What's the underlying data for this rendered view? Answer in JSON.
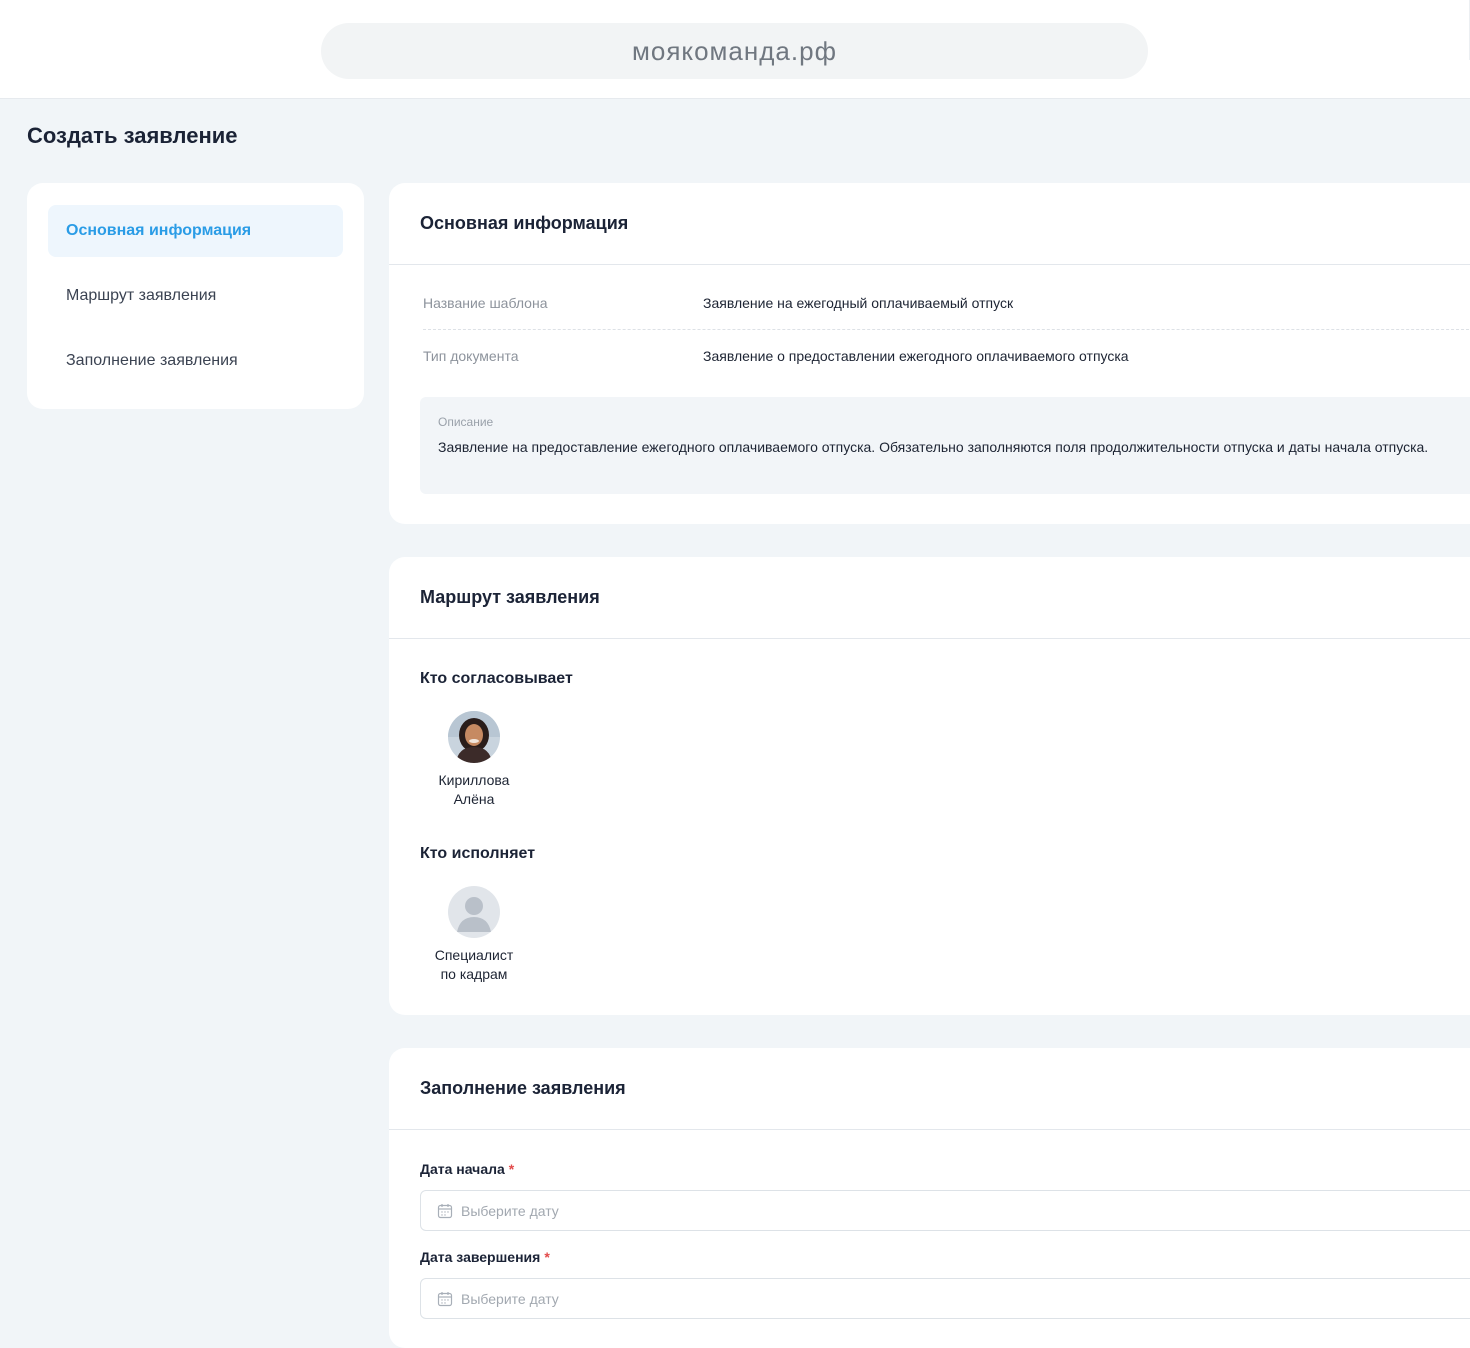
{
  "browser": {
    "url": "моякоманда.рф"
  },
  "page": {
    "title": "Создать заявление"
  },
  "sidebar": {
    "items": [
      {
        "label": "Основная информация",
        "active": true
      },
      {
        "label": "Маршрут заявления",
        "active": false
      },
      {
        "label": "Заполнение заявления",
        "active": false
      }
    ]
  },
  "main_info": {
    "title": "Основная информация",
    "template_name_label": "Название шаблона",
    "template_name_value": "Заявление на ежегодный оплачиваемый отпуск",
    "doc_type_label": "Тип документа",
    "doc_type_value": "Заявление о предоставлении ежегодного оплачиваемого отпуска",
    "description_label": "Описание",
    "description_text": "Заявление на предоставление ежегодного оплачиваемого отпуска. Обязательно заполняются поля продолжительности отпуска и даты начала отпуска."
  },
  "route": {
    "title": "Маршрут заявления",
    "approver_heading": "Кто согласовывает",
    "approver_name_line1": "Кириллова",
    "approver_name_line2": "Алёна",
    "executor_heading": "Кто исполняет",
    "executor_name_line1": "Специалист",
    "executor_name_line2": "по кадрам"
  },
  "fill": {
    "title": "Заполнение заявления",
    "start_date_label": "Дата начала",
    "end_date_label": "Дата завершения",
    "required_mark": "*",
    "date_placeholder": "Выберите дату"
  },
  "colors": {
    "accent": "#2a9ce6",
    "background": "#f1f5f8",
    "required": "#e24a4a"
  }
}
